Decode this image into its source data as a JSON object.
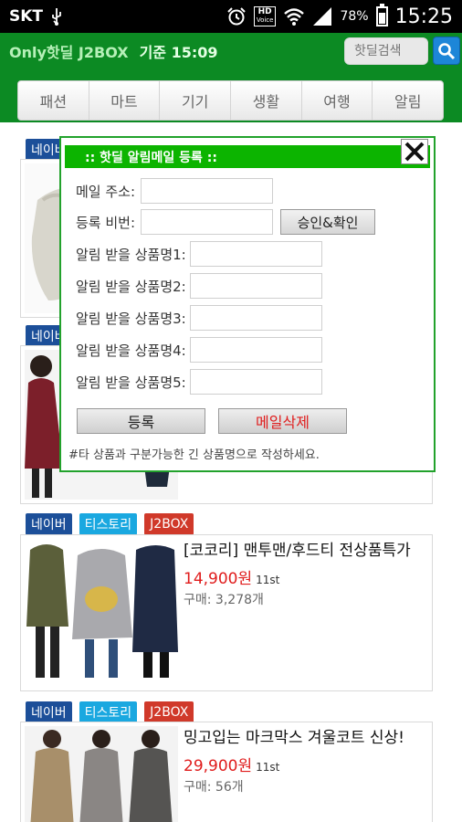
{
  "status_bar": {
    "carrier": "SKT",
    "hd_label": "HD",
    "voice_label": "Voice",
    "battery": "78%",
    "battery_level": 0.78,
    "time": "15:25"
  },
  "header": {
    "brand": "Only핫딜 J2BOX",
    "as_of": "기준 15:09",
    "search_placeholder": "핫딜검색"
  },
  "tabs": [
    "패션",
    "마트",
    "기기",
    "생활",
    "여행",
    "알림"
  ],
  "modal": {
    "title": ":: 핫딜 알림메일 등록 ::",
    "email_label": "메일 주소:",
    "email_value": "",
    "pin_label": "등록 비번:",
    "pin_value": "",
    "confirm_button": "승인&확인",
    "item_labels": [
      "알림 받을 상품명1:",
      "알림 받을 상품명2:",
      "알림 받을 상품명3:",
      "알림 받을 상품명4:",
      "알림 받을 상품명5:"
    ],
    "item_values": [
      "",
      "",
      "",
      "",
      ""
    ],
    "register_button": "등록",
    "delete_button": "메일삭제",
    "note": "#타 상품과 구분가능한 긴 상품명으로 작성하세요."
  },
  "badges": {
    "naver": "네이버",
    "tistory": "티스토리",
    "j2box": "J2BOX"
  },
  "products": [
    {
      "title": "",
      "price": "",
      "shop": "",
      "buy": ""
    },
    {
      "title": "",
      "price": "",
      "shop": "",
      "buy": ""
    },
    {
      "title": "[코코리] 맨투맨/후드티 전상품특가",
      "price": "14,900원",
      "shop": "11st",
      "buy": "구매: 3,278개"
    },
    {
      "title": "밍고입는 마크막스 겨울코트 신상!",
      "price": "29,900원",
      "shop": "11st",
      "buy": "구매: 56개"
    }
  ],
  "colors": {
    "header_green": "#0c8a23",
    "modal_head_green": "#0cb400",
    "price_red": "#e01c1c",
    "naver_blue": "#1c4f99",
    "tistory_blue": "#1aa8e0",
    "j2box_red": "#d0392a"
  }
}
